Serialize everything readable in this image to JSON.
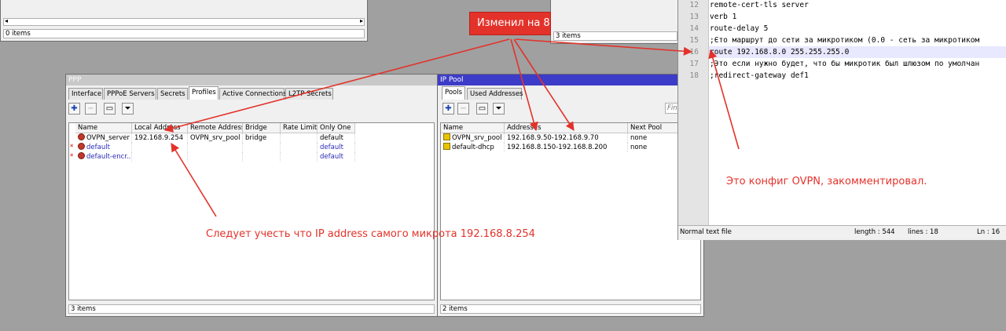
{
  "top_left_window": {
    "status": "0 items"
  },
  "top_mid_window": {
    "status": "3 items"
  },
  "ppp": {
    "title": "PPP",
    "tabs": [
      "Interface",
      "PPPoE Servers",
      "Secrets",
      "Profiles",
      "Active Connections",
      "L2TP Secrets"
    ],
    "active_tab": "Profiles",
    "columns": [
      "Name",
      "Local Address",
      "Remote Address",
      "Bridge",
      "Rate Limit...",
      "Only One"
    ],
    "rows": [
      {
        "mark": "",
        "name": "OVPN_server",
        "local": "192.168.9.254",
        "remote": "OVPN_srv_pool",
        "bridge": "bridge",
        "rate": "",
        "only_one": "default"
      },
      {
        "mark": "*",
        "name": "default",
        "local": "",
        "remote": "",
        "bridge": "",
        "rate": "",
        "only_one": "default"
      },
      {
        "mark": "*",
        "name": "default-encr...",
        "local": "",
        "remote": "",
        "bridge": "",
        "rate": "",
        "only_one": "default"
      }
    ],
    "status": "3 items"
  },
  "ippool": {
    "title": "IP Pool",
    "tabs": [
      "Pools",
      "Used Addresses"
    ],
    "active_tab": "Pools",
    "find_placeholder": "Fin",
    "columns": [
      "Name",
      "Addresses",
      "Next Pool"
    ],
    "rows": [
      {
        "name": "OVPN_srv_pool",
        "addresses": "192.168.9.50-192.168.9.70",
        "next": "none"
      },
      {
        "name": "default-dhcp",
        "addresses": "192.168.8.150-192.168.8.200",
        "next": "none"
      }
    ],
    "status": "2 items"
  },
  "editor": {
    "lines": [
      {
        "n": "12",
        "text": "remote-cert-tls server"
      },
      {
        "n": "13",
        "text": "verb 1"
      },
      {
        "n": "14",
        "text": "route-delay 5"
      },
      {
        "n": "15",
        "text": ";Єто маршрут до сети за микротиком (0.0 - сеть за микротиком"
      },
      {
        "n": "16",
        "text": "route 192.168.8.0 255.255.255.0"
      },
      {
        "n": "17",
        "text": ";Это если нужно будет, что бы микротик был шлюзом по умолчан"
      },
      {
        "n": "18",
        "text": ";redirect-gateway def1"
      }
    ],
    "status_type": "Normal text file",
    "status_length": "length : 544",
    "status_lines": "lines : 18",
    "status_ln": "Ln : 16"
  },
  "annotations": {
    "changed": "Изменил на 8",
    "note_ip": "Следует учесть что IP address самого микрота 192.168.8.254",
    "note_config": "Это конфиг OVPN, закомментировал."
  },
  "colors": {
    "annotation": "#e3322a",
    "ppp_title": "#c8c8c8",
    "ippool_title": "#3c3cc8",
    "highlight_line": "#e8e8ff"
  }
}
